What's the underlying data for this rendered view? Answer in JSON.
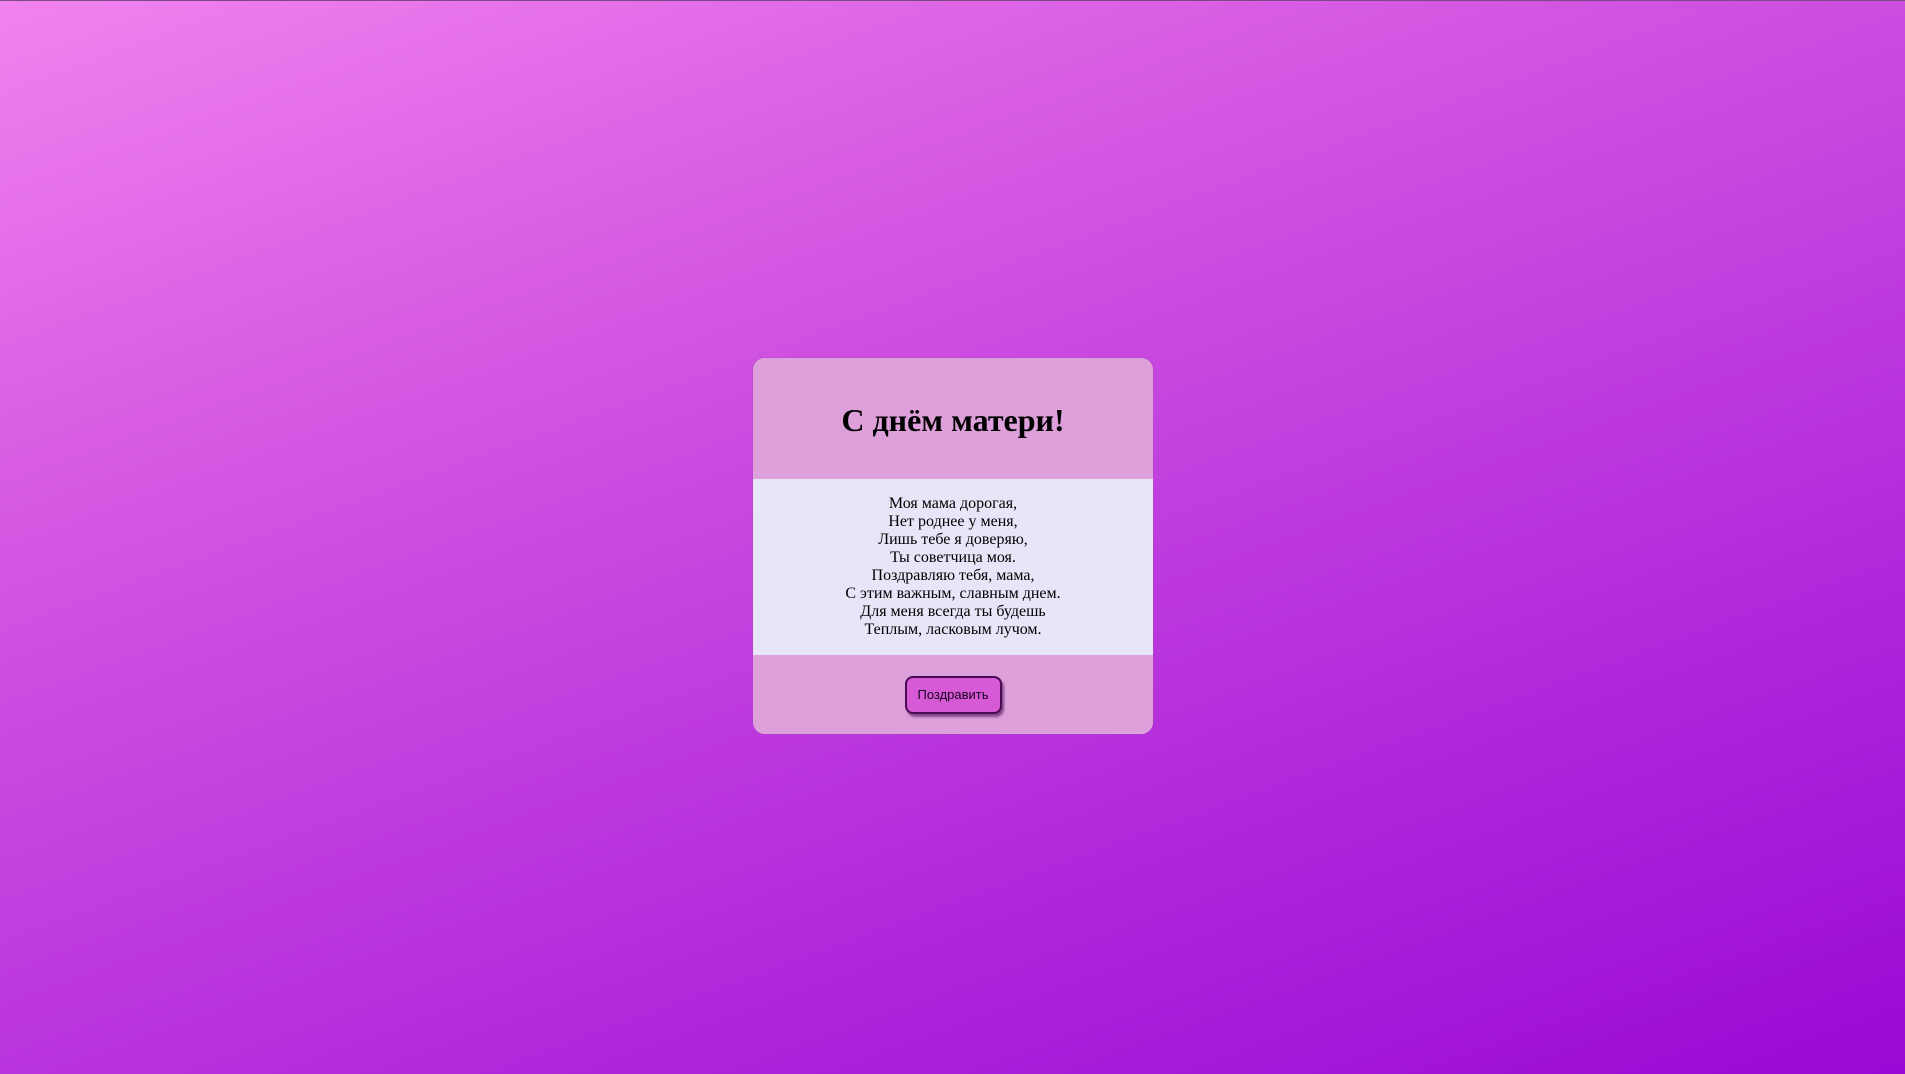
{
  "card": {
    "title": "С днём матери!",
    "poem": [
      "Моя мама дорогая,",
      "Нет роднее у меня,",
      "Лишь тебе я доверяю,",
      "Ты советчица моя.",
      "Поздравляю тебя, мама,",
      "С этим важным, славным днем.",
      "Для меня всегда ты будешь",
      "Теплым, ласковым лучом."
    ],
    "button_label": "Поздравить"
  },
  "colors": {
    "background_gradient": [
      "#f282ef",
      "#9a08d5"
    ],
    "card_header": "#dea0da",
    "card_body": "#e6e6f8",
    "button": "#d65ad6"
  }
}
